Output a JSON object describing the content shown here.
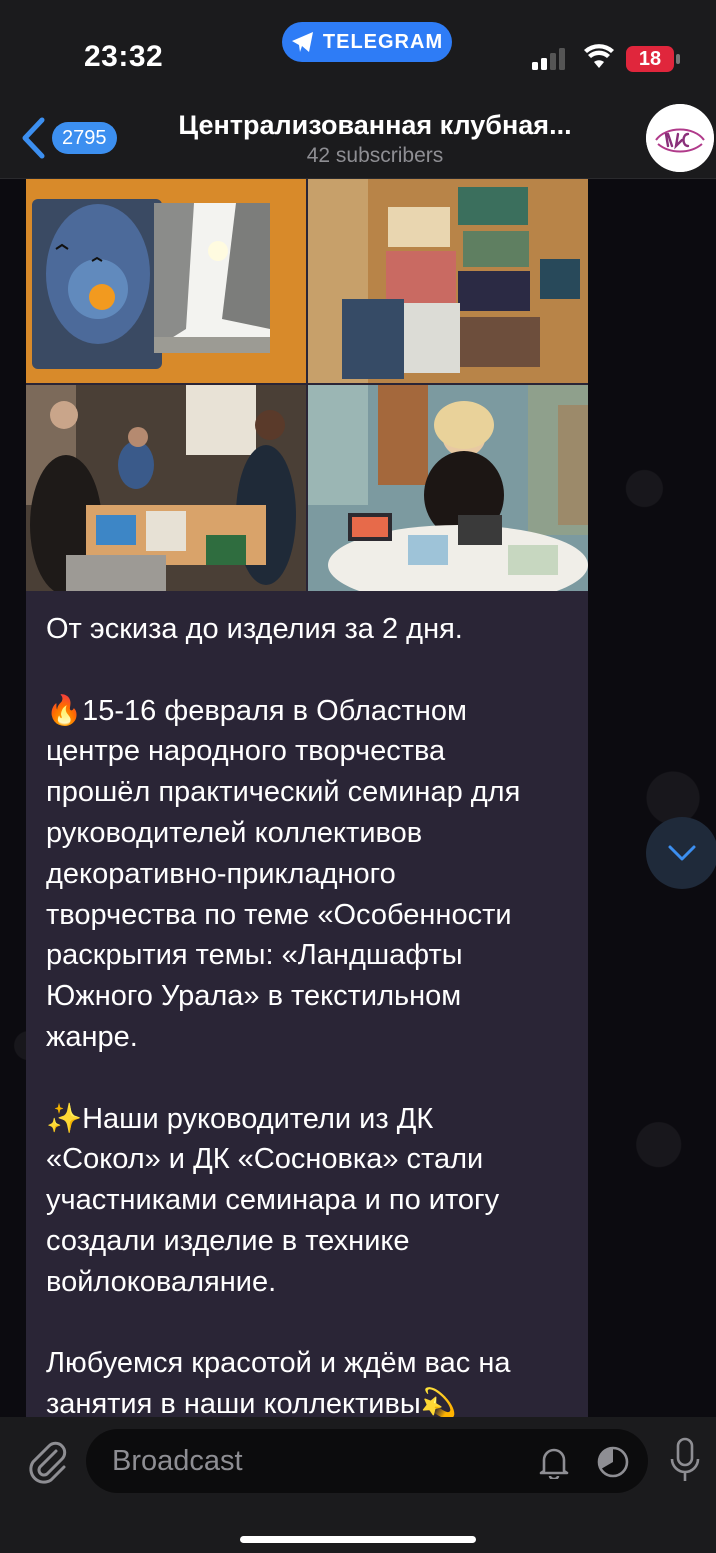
{
  "status_bar": {
    "time": "23:32",
    "app_pill": "TELEGRAM",
    "battery": "18",
    "colors": {
      "pill": "#2e7cf6",
      "battery": "#e0263c"
    }
  },
  "header": {
    "back_count": "2795",
    "title": "Централизованная клубная...",
    "subtitle": "42 subscribers",
    "avatar_icon": "channel-logo"
  },
  "message": {
    "photos": [
      "felt-art-photo",
      "artworks-table-photo",
      "workshop-people-photo",
      "woman-painting-photo"
    ],
    "lines": [
      "От эскиза до изделия за 2 дня.",
      "",
      "🔥15-16 февраля в Областном",
      "центре народного творчества",
      "прошёл практический семинар для",
      "руководителей коллективов",
      "декоративно-прикладного",
      "творчества по теме «Особенности",
      "раскрытия темы: «Ландшафты",
      "Южного Урала» в текстильном",
      "жанре.",
      "",
      "✨Наши руководители из ДК",
      "«Сокол» и ДК «Сосновка» стали",
      "участниками семинара и по итогу",
      "создали изделие в технике",
      "войлоковаляние.",
      "",
      "Любуемся красотой и ждём вас на",
      "занятия в наши коллективы💫"
    ]
  },
  "composer": {
    "placeholder": "Broadcast"
  },
  "icons": {
    "attach": "paperclip-icon",
    "bell": "bell-icon",
    "timer": "timer-icon",
    "mic": "microphone-icon",
    "scroll_down": "chevron-down-icon"
  }
}
